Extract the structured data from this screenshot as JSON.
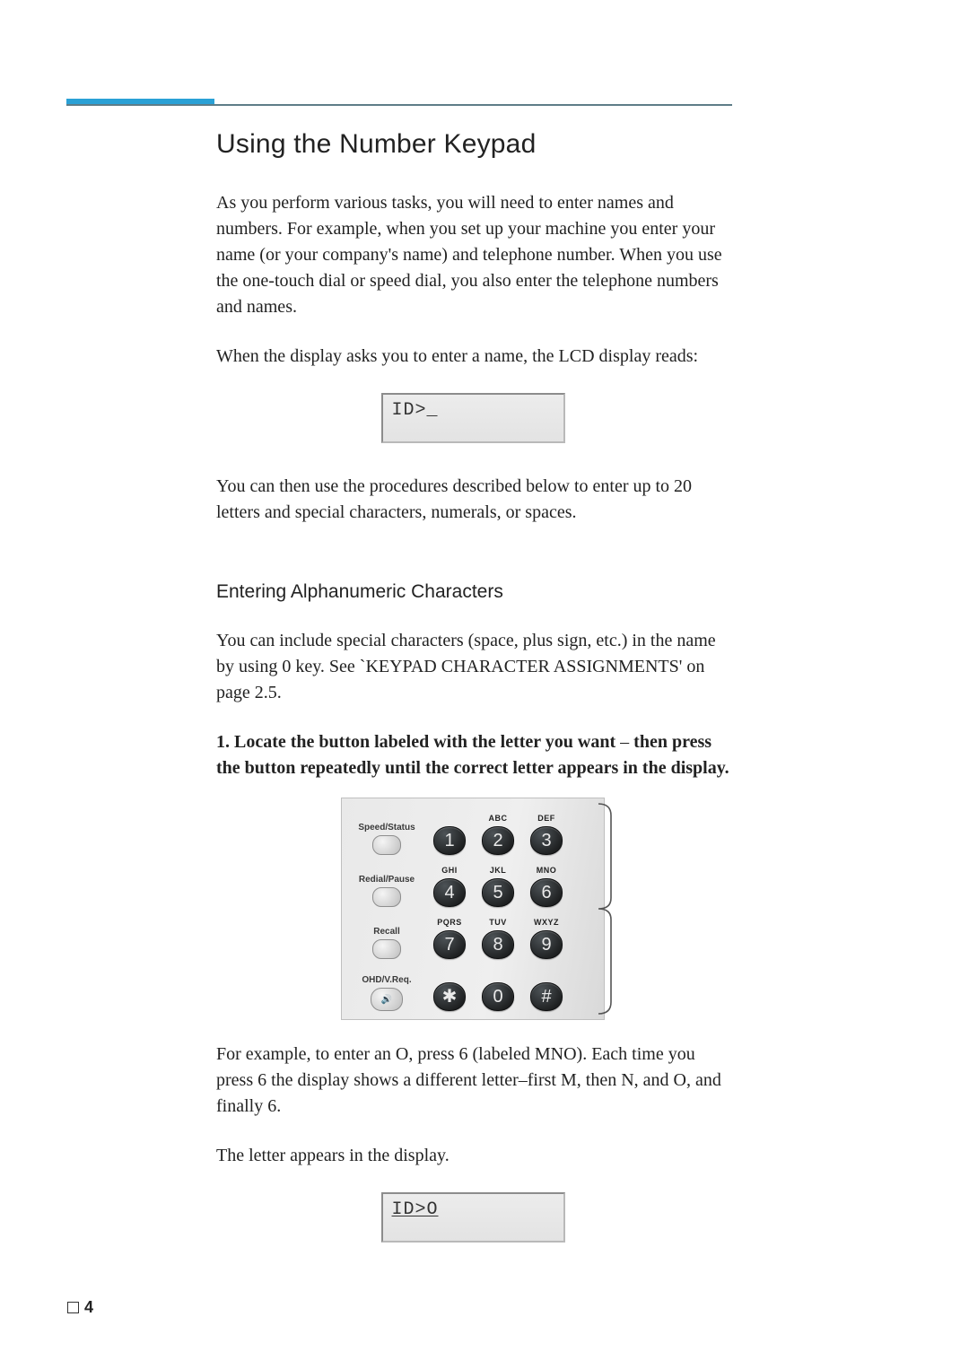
{
  "heading": "Using the Number Keypad",
  "para1": "As you perform various tasks, you will need to enter names and numbers. For example, when you set up your machine you enter your name (or your company's name) and telephone number. When you use the one-touch dial or speed dial, you also enter the telephone numbers and names.",
  "para2": "When the display asks you to enter a name, the LCD display reads:",
  "lcd1": "ID>_",
  "para3": "You can then use the procedures described below to enter up to 20 letters and special characters, numerals, or spaces.",
  "subheading": "Entering Alphanumeric Characters",
  "para4": "You can include special characters (space, plus sign, etc.) in the name by using 0 key. See `KEYPAD CHARACTER ASSIGNMENTS' on page 2.5.",
  "step1_num": "1.",
  "step1_bold_a": "Locate the button labeled with the letter you want",
  "step1_dash": " – ",
  "step1_bold_b": "then press the button repeatedly until the correct letter appears in the display.",
  "step1_body": "For example, to enter an O, press 6 (labeled MNO). Each time you press 6 the display shows a different letter–first M, then N, and O, and finally 6.",
  "step1_body2": "The letter appears in the display.",
  "lcd2": "ID>O",
  "keypad": {
    "side": [
      {
        "label": "Speed/Status"
      },
      {
        "label": "Redial/Pause"
      },
      {
        "label": "Recall"
      },
      {
        "label": "OHD/V.Req."
      }
    ],
    "rows": [
      [
        {
          "label": "",
          "key": "1"
        },
        {
          "label": "ABC",
          "key": "2"
        },
        {
          "label": "DEF",
          "key": "3"
        }
      ],
      [
        {
          "label": "GHI",
          "key": "4"
        },
        {
          "label": "JKL",
          "key": "5"
        },
        {
          "label": "MNO",
          "key": "6"
        }
      ],
      [
        {
          "label": "PQRS",
          "key": "7"
        },
        {
          "label": "TUV",
          "key": "8"
        },
        {
          "label": "WXYZ",
          "key": "9"
        }
      ],
      [
        {
          "label": "",
          "key": "✱"
        },
        {
          "label": "",
          "key": "0"
        },
        {
          "label": "",
          "key": "#"
        }
      ]
    ]
  },
  "page_number": "4"
}
